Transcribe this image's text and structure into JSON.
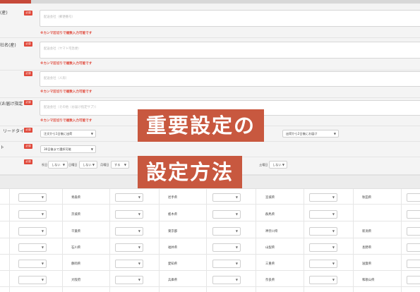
{
  "rows": [
    {
      "label": "(産)",
      "badge": "必須",
      "placeholder": "配送会社（郵便番号）",
      "note": "※カンマ区切りで複数入力可能です"
    },
    {
      "label": "社名(産)",
      "badge": "必須",
      "placeholder": "配送会社（ヤマト宅急便）",
      "note": "※カンマ区切りで複数入力可能です"
    },
    {
      "label": "",
      "badge": "必須",
      "placeholder": "配送会社（人形）",
      "note": "※カンマ区切りで複数入力可能です"
    },
    {
      "label": "(お届け指定",
      "badge": "必須",
      "placeholder": "配送会社（その他（お届け指定サプ））",
      "note": "※カンマ区切りで複数入力可能です"
    }
  ],
  "leadtime": {
    "label": "リードタイム",
    "badge": "必須",
    "select1": "注文から1日後に出荷",
    "select2": "出荷から2日後にお届け"
  },
  "delivery_select": {
    "label": "ト",
    "badge": "必須",
    "value": "30日後まで選択可能"
  },
  "holiday": {
    "badge": "必須",
    "items": [
      {
        "label": "祝日",
        "value": "しない"
      },
      {
        "label": "日曜日",
        "value": "しない"
      },
      {
        "label": "月曜日",
        "value": "する"
      }
    ],
    "saturday": {
      "label": "土曜日",
      "value": "しない"
    }
  },
  "prefectures": [
    [
      "青森県",
      "岩手県",
      "宮城県",
      "秋田県"
    ],
    [
      "茨城県",
      "栃木県",
      "群馬県"
    ],
    [
      "千葉県",
      "東京都",
      "神奈川県",
      "新潟県"
    ],
    [
      "石川県",
      "福井県",
      "山梨県",
      "長野県"
    ],
    [
      "静岡県",
      "愛知県",
      "三重県",
      "滋賀県"
    ],
    [
      "大阪府",
      "兵庫県",
      "奈良県",
      "和歌山県"
    ]
  ],
  "overlay": {
    "line1": "重要設定の",
    "line2": "設定方法"
  }
}
